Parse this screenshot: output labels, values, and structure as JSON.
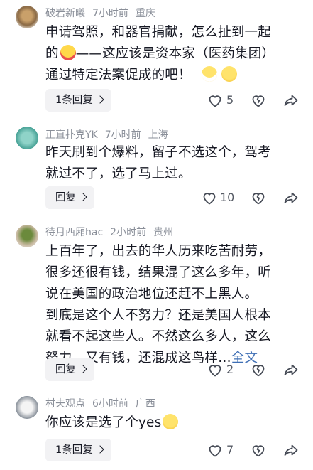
{
  "comments": [
    {
      "user": "破岩新曦",
      "time": "7小时前",
      "location": "重庆",
      "lines": [
        "申请驾照，和器官捐献，怎么扯到一起",
        "的",
        "——这应该是资本家（医药集团）",
        "通过特定法案促成的吧！"
      ],
      "reply_label": "1条回复",
      "like_count": "5"
    },
    {
      "user": "正直扑克YK",
      "time": "7小时前",
      "location": "上海",
      "lines": [
        "昨天刷到个爆料，留子不选这个，驾考",
        "就过不了，选了马上过。"
      ],
      "reply_label": "回复",
      "like_count": "10"
    },
    {
      "user": "待月西厢hac",
      "time": "2小时前",
      "location": "贵州",
      "lines": [
        "上百年了，出去的华人历来吃苦耐劳，",
        "很多还很有钱，结果混了这么多年，听",
        "说在美国的政治地位还赶不上黑人。",
        "到底是这个人不努力？还是美国人根本",
        "就看不起这些人。不然这么多人，这么",
        "努力，又有钱，还混成这鸟样…"
      ],
      "more_label": "全文",
      "reply_label": "回复",
      "like_count": "2"
    },
    {
      "user": "村夫观点",
      "time": "6小时前",
      "location": "广西",
      "lines": [
        "你应该是选了个yes"
      ],
      "reply_label": "1条回复",
      "like_count": "7"
    }
  ],
  "colors": {
    "meta": "#8a8f99",
    "text": "#161823",
    "link": "#3f6fb5",
    "button_bg": "#f2f2f4"
  }
}
